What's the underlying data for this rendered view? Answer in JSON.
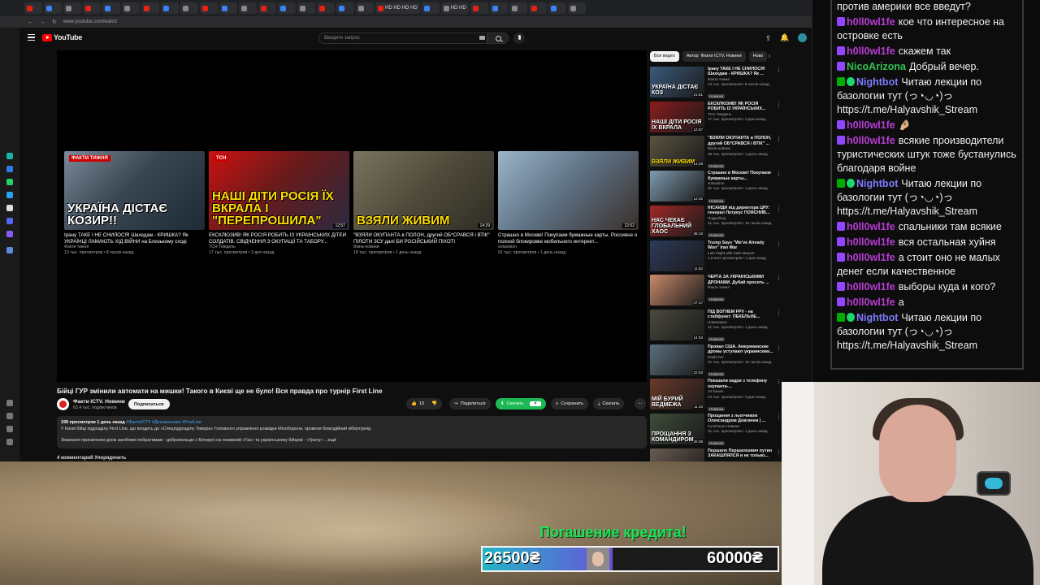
{
  "browser": {
    "tabs": [
      "",
      "",
      "",
      "",
      "",
      "",
      "",
      "",
      "",
      "",
      "",
      "",
      "",
      "",
      "",
      "",
      "",
      "",
      "HD HD HD HD",
      "",
      "HD HD",
      "",
      "",
      "",
      "",
      "",
      ""
    ],
    "url": "www.youtube.com/watch"
  },
  "youtube": {
    "logo": "YouTube",
    "search_placeholder": "Введите запрос",
    "video": {
      "title": "Бійці ГУР змінили автомати на мишки! Такого в Києві ще не було! Вся правда про турнір First Line",
      "channel": "Факти ICTV. Новини",
      "subs": "63,4 тыс. подписчиков",
      "subscribe": "Подписаться",
      "likes": "10",
      "share": "Поделиться",
      "download_green": "Скачать",
      "save": "Сохранить",
      "download": "Скачать",
      "desc_meta": "199 просмотров  1 день назад",
      "desc_tags": "#ФактиICTV #Деньвоєнних #FirstLine",
      "desc_line1": "У Києві бійці підрозділу First Line, що входить до «Спецпідрозділу Тимура» Головного управління розвідки Міноборони, провели благодійний кібертурнір.",
      "desc_line2": "Змагання присвятили досм загиблим побратимам · добровольцю з Білорусі на позивний «Газ» та українському бійцеві · «Грачу» ...ещё",
      "comments": "4 комментарий   Упорядочить"
    },
    "endcards": [
      {
        "overlay": "Україна дістає козир!!",
        "brand": "ФАКТИ ТИЖНЯ",
        "title": "Ірану ТАКЕ І НЕ СНИЛОСЯ! Шахедам - КРИШКА? Як УКРАЇНЦІ ЛАМАЮТЬ ХІД ВІЙНИ на Близькому сході",
        "channel": "Факти тижня",
        "meta": "13 тыс. просмотров • 8 часов назад",
        "dur": ""
      },
      {
        "overlay": "Наші діти Росія їх вкрала і \"перепрошила\"",
        "brand": "ТСН",
        "title": "ЕКСКЛЮЗИВ! ЯК РОСІЯ РОБИТЬ ІЗ УКРАЇНСЬКИХ ДІТЕЙ СОЛДАТІВ. СВІДЧЕННЯ З ОКУПАЦІЇ ТА ТАБОРУ...",
        "channel": "ТСН Тиждень",
        "meta": "17 тыс. просмотров • 3 дня назад",
        "dur": "12:57"
      },
      {
        "overlay": "Взяли живим",
        "brand": "",
        "title": "\"ВЗЯЛИ ОКУПАНТА в ПОЛОН, другий ОБ*СРАВСЯ і ВТІК\" ПІЛОТИ ЗСУ далі БИ РОСІЙСЬКИЙ ПІХОТІ",
        "channel": "Вікна-новини",
        "meta": "18 тыс. просмотров • 1 день назад",
        "dur": "14:29"
      },
      {
        "overlay": "",
        "brand": "",
        "title": "Страшно в Москве! Покупаем бумажные карты. Россияне о полной блокировке мобильного интернет...",
        "channel": "sotavision",
        "meta": "91 тыс. просмотров • 1 день назад",
        "dur": "12:02"
      }
    ],
    "chips": [
      "Все видео",
      "Автор: Факти ICTV. Новини",
      "Ново"
    ],
    "sidebar": [
      {
        "overlay": "Україна дістає коз",
        "title": "Ірану ТАКЕ І НЕ СНИЛОСЯ! Шахедам - КРИШКА? Як ...",
        "channel": "Факти тижня",
        "meta": "13 тыс. просмотров • 8 часов назад",
        "badge": "Новинка",
        "dur": "21:51"
      },
      {
        "overlay": "Наші діти Росія їх вкрала",
        "title": "ЕКСКЛЮЗИВ! ЯК РОСІЯ РОБИТЬ ІЗ УКРАЇНСЬКИХ...",
        "channel": "ТСН Тиждень",
        "meta": "17 тыс. просмотров • 3 дня назад",
        "badge": "",
        "dur": "12:57"
      },
      {
        "overlay": "Взяли живим",
        "title": "\"ВЗЯЛИ ОКУПАНТА в ПОЛОН, другий ОБ*СРАВСЯ і ВТІК\" ...",
        "channel": "Вікна-новини",
        "meta": "18 тыс. просмотров • 1 день назад",
        "badge": "Новинка",
        "dur": "14:29"
      },
      {
        "overlay": "",
        "title": "Страшно в Москве! Покупаем бумажные карты...",
        "channel": "sotavision",
        "meta": "91 тыс. просмотров • 1 день назад",
        "badge": "Новинка",
        "dur": "12:02"
      },
      {
        "overlay": "Нас чекає глобальний хаос",
        "title": "ІНСАЙДИ від директора ЦРУ: генерал Петреус ПОЯСНИВ...",
        "channel": "Подробиці",
        "meta": "21 тыс. просмотров • 16 часов назад",
        "badge": "Новинка",
        "dur": "36:10"
      },
      {
        "overlay": "",
        "title": "Trump Says \"We've Already Won\" Iran War",
        "channel": "Late Night with Seth Meyers",
        "meta": "1,8 млн просмотров • 4 дня назад",
        "badge": "",
        "dur": "11:52"
      },
      {
        "overlay": "",
        "title": "ЧЕРГА ЗА УКРАЇНСЬКИМИ ДРОНАМИ. Дубай просить ...",
        "channel": "Факти тижня",
        "meta": "",
        "badge": "Новинка",
        "dur": "47:17"
      },
      {
        "overlay": "",
        "title": "ПІД ВОГНЕМ FPV - на стабфункт: ПЕКЕЛЬНЕ...",
        "channel": "Новинарня",
        "meta": "21 тыс. просмотров • 1 день назад",
        "badge": "Новинка",
        "dur": "14:03"
      },
      {
        "overlay": "",
        "title": "Провал США. Американские дроны уступают украинским...",
        "channel": "Radio NV",
        "meta": "21 тыс. просмотров • 16 часов назад",
        "badge": "Новинка",
        "dur": "22:53"
      },
      {
        "overlay": "Мій бурий ведмежа",
        "title": "Показали кадри з телефону окупанта-...",
        "channel": "24 Канал",
        "meta": "24 тыс. просмотров • 3 дня назад",
        "badge": "Новинка",
        "dur": "11:10"
      },
      {
        "overlay": "Прощання з командиром",
        "title": "Прощання з льотчиком Олександром Довгачем | ...",
        "channel": "Суспільне Новини",
        "meta": "21 тыс. просмотров • 1 день назад",
        "badge": "Новинка",
        "dur": "20:39"
      },
      {
        "overlay": "",
        "title": "Першило Першилоэвич путин ЗАКАШЛЯЛСЯ и не только...",
        "channel": "",
        "meta": "",
        "badge": "",
        "dur": ""
      }
    ]
  },
  "chat": {
    "messages": [
      {
        "badges": [],
        "user": "",
        "text": "против америки все введут?",
        "color": "#f0f0f0"
      },
      {
        "badges": [
          "tw"
        ],
        "user": "h0ll0wl1fe",
        "text": "кое что интересное на островке есть",
        "color": "#b83dd6"
      },
      {
        "badges": [
          "tw"
        ],
        "user": "h0ll0wl1fe",
        "text": "скажем так",
        "color": "#b83dd6"
      },
      {
        "badges": [
          "tw"
        ],
        "user": "NicoArizona",
        "text": "Добрый вечер.",
        "color": "#34c14f"
      },
      {
        "badges": [
          "mod",
          "bot"
        ],
        "user": "Nightbot",
        "text": "Читаю лекции по базологии тут (っ◔◡◔)っ https://t.me/Halyavshik_Stream",
        "color": "#7c7cff"
      },
      {
        "badges": [
          "tw"
        ],
        "user": "h0ll0wl1fe",
        "text": "🤌🏼",
        "color": "#b83dd6"
      },
      {
        "badges": [
          "tw"
        ],
        "user": "h0ll0wl1fe",
        "text": "всякие производители туристических штук тоже бустанулись благодаря войне",
        "color": "#b83dd6"
      },
      {
        "badges": [
          "mod",
          "bot"
        ],
        "user": "Nightbot",
        "text": "Читаю лекции по базологии тут (っ◔◡◔)っ https://t.me/Halyavshik_Stream",
        "color": "#7c7cff"
      },
      {
        "badges": [
          "tw"
        ],
        "user": "h0ll0wl1fe",
        "text": "спальники там всякие",
        "color": "#b83dd6"
      },
      {
        "badges": [
          "tw"
        ],
        "user": "h0ll0wl1fe",
        "text": "вся остальная хуйня",
        "color": "#b83dd6"
      },
      {
        "badges": [
          "tw"
        ],
        "user": "h0ll0wl1fe",
        "text": "а стоит оно не малых денег если качественное",
        "color": "#b83dd6"
      },
      {
        "badges": [
          "tw"
        ],
        "user": "h0ll0wl1fe",
        "text": "выборы куда и кого?",
        "color": "#b83dd6"
      },
      {
        "badges": [
          "tw"
        ],
        "user": "h0ll0wl1fe",
        "text": "а",
        "color": "#b83dd6"
      },
      {
        "badges": [
          "mod",
          "bot"
        ],
        "user": "Nightbot",
        "text": "Читаю лекции по базологии тут (っ◔◡◔)っ https://t.me/Halyavshik_Stream",
        "color": "#7c7cff"
      }
    ]
  },
  "overlay": {
    "title": "Погашение кредита!",
    "current": "26500₴",
    "target": "60000₴",
    "progress": 0.44
  }
}
